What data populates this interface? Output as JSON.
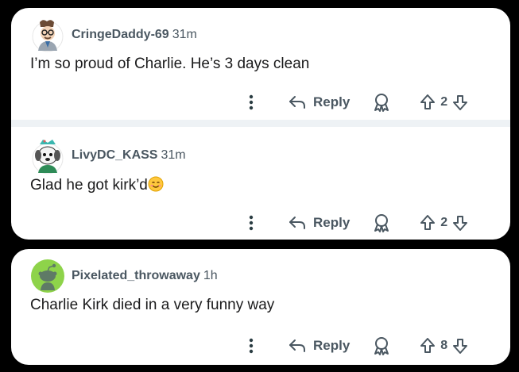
{
  "comments": [
    {
      "username": "CringeDaddy-69",
      "time": "31m",
      "text": "I’m so proud of Charlie. He’s 3 days clean",
      "emoji": "",
      "reply_label": "Reply",
      "votes": "2",
      "avatar_icon": "man-with-glasses-avatar-icon"
    },
    {
      "username": "LivyDC_KASS",
      "time": "31m",
      "text": "Glad he got kirk’d",
      "emoji": "smiling-face-icon",
      "reply_label": "Reply",
      "votes": "2",
      "avatar_icon": "white-dog-avatar-icon"
    },
    {
      "username": "Pixelated_throwaway",
      "time": "1h",
      "text": "Charlie Kirk died in a very funny way",
      "emoji": "",
      "reply_label": "Reply",
      "votes": "8",
      "avatar_icon": "snoo-green-avatar-icon"
    }
  ],
  "colors": {
    "background": "#000000",
    "card": "#ffffff",
    "meta_text": "#4a5761",
    "body_text": "#1a1a1b",
    "divider": "#eef2f5"
  }
}
